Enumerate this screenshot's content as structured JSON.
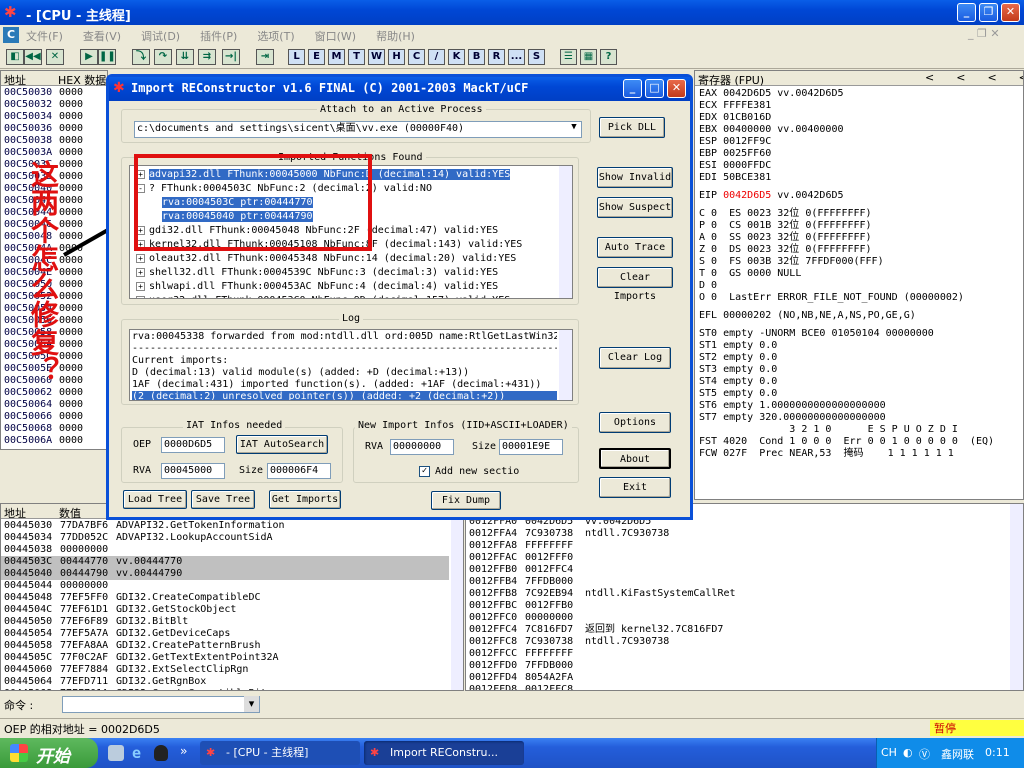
{
  "main_window": {
    "title": "- [CPU - 主线程]",
    "menu": [
      "文件(F)",
      "查看(V)",
      "调试(D)",
      "插件(P)",
      "选项(T)",
      "窗口(W)",
      "帮助(H)"
    ],
    "toolbar_letters": [
      "L",
      "E",
      "M",
      "T",
      "W",
      "H",
      "C",
      "/",
      "K",
      "B",
      "R",
      "...",
      "S"
    ]
  },
  "dump_panel": {
    "col_addr": "地址",
    "col_hex": "HEX 数据",
    "rows": [
      [
        "00C50030",
        "0000"
      ],
      [
        "00C50032",
        "0000"
      ],
      [
        "00C50034",
        "0000"
      ],
      [
        "00C50036",
        "0000"
      ],
      [
        "00C50038",
        "0000"
      ],
      [
        "00C5003A",
        "0000"
      ],
      [
        "00C5003C",
        "0000"
      ],
      [
        "00C5003E",
        "0000"
      ],
      [
        "00C50040",
        "0000"
      ],
      [
        "00C50042",
        "0000"
      ],
      [
        "00C50044",
        "0000"
      ],
      [
        "00C50046",
        "0000"
      ],
      [
        "00C50048",
        "0000"
      ],
      [
        "00C5004A",
        "0000"
      ],
      [
        "00C5004C",
        "0000"
      ],
      [
        "00C5004E",
        "0000"
      ],
      [
        "00C50050",
        "0000"
      ],
      [
        "00C50052",
        "0000"
      ],
      [
        "00C50054",
        "0000"
      ],
      [
        "00C50056",
        "0000"
      ],
      [
        "00C50058",
        "0000"
      ],
      [
        "00C5005A",
        "0000"
      ],
      [
        "00C5005C",
        "0000"
      ],
      [
        "00C5005E",
        "0000"
      ],
      [
        "00C50060",
        "0000"
      ],
      [
        "00C50062",
        "0000"
      ],
      [
        "00C50064",
        "0000"
      ],
      [
        "00C50066",
        "0000"
      ],
      [
        "00C50068",
        "0000"
      ],
      [
        "00C5006A",
        "0000"
      ]
    ]
  },
  "annotation": {
    "text": "这两个怎么修复？"
  },
  "registers": {
    "header": "寄存器 (FPU)",
    "nav": [
      "<",
      "<",
      "<",
      "<",
      ">"
    ],
    "lines": [
      {
        "t": "EAX 0042D6D5 vv.0042D6D5"
      },
      {
        "t": "ECX FFFFE381"
      },
      {
        "t": "EDX 01CB016D"
      },
      {
        "t": "EBX 00400000 vv.00400000"
      },
      {
        "t": "ESP 0012FF9C"
      },
      {
        "t": "EBP 0025FF60"
      },
      {
        "t": "ESI 0000FFDC"
      },
      {
        "t": "EDI 50BCE381"
      },
      {
        "t": ""
      },
      {
        "t": "EIP ",
        "red": "0042D6D5",
        "rest": " vv.0042D6D5"
      },
      {
        "t": ""
      },
      {
        "t": "C 0  ES 0023 32位 0(FFFFFFFF)"
      },
      {
        "t": "P 0  CS 001B 32位 0(FFFFFFFF)"
      },
      {
        "t": "A 0  SS 0023 32位 0(FFFFFFFF)"
      },
      {
        "t": "Z 0  DS 0023 32位 0(FFFFFFFF)"
      },
      {
        "t": "S 0  FS 003B 32位 7FFDF000(FFF)"
      },
      {
        "t": "T 0  GS 0000 NULL"
      },
      {
        "t": "D 0"
      },
      {
        "t": "O 0  LastErr ERROR_FILE_NOT_FOUND (00000002)"
      },
      {
        "t": ""
      },
      {
        "t": "EFL 00000202 (NO,NB,NE,A,NS,PO,GE,G)"
      },
      {
        "t": ""
      },
      {
        "t": "ST0 empty -UNORM BCE0 01050104 00000000"
      },
      {
        "t": "ST1 empty 0.0"
      },
      {
        "t": "ST2 empty 0.0"
      },
      {
        "t": "ST3 empty 0.0"
      },
      {
        "t": "ST4 empty 0.0"
      },
      {
        "t": "ST5 empty 0.0"
      },
      {
        "t": "ST6 empty 1.0000000000000000000"
      },
      {
        "t": "ST7 empty 320.00000000000000000"
      },
      {
        "t": "               3 2 1 0      E S P U O Z D I"
      },
      {
        "t": "FST 4020  Cond 1 0 0 0  Err 0 0 1 0 0 0 0 0  (EQ)"
      },
      {
        "t": "FCW 027F  Prec NEAR,53  掩码    1 1 1 1 1 1"
      }
    ]
  },
  "iat_panel": {
    "col_addr": "地址",
    "col_val": "数值",
    "rows": [
      {
        "a": "00445030",
        "v": "77DA7BF6",
        "c": "ADVAPI32.GetTokenInformation"
      },
      {
        "a": "00445034",
        "v": "77DD052C",
        "c": "ADVAPI32.LookupAccountSidA"
      },
      {
        "a": "00445038",
        "v": "00000000",
        "c": ""
      },
      {
        "a": "0044503C",
        "v": "00444770",
        "c": "vv.00444770",
        "hl": true
      },
      {
        "a": "00445040",
        "v": "00444790",
        "c": "vv.00444790",
        "hl": true
      },
      {
        "a": "00445044",
        "v": "00000000",
        "c": ""
      },
      {
        "a": "00445048",
        "v": "77EF5FF0",
        "c": "GDI32.CreateCompatibleDC"
      },
      {
        "a": "0044504C",
        "v": "77EF61D1",
        "c": "GDI32.GetStockObject"
      },
      {
        "a": "00445050",
        "v": "77EF6F89",
        "c": "GDI32.BitBlt"
      },
      {
        "a": "00445054",
        "v": "77EF5A7A",
        "c": "GDI32.GetDeviceCaps"
      },
      {
        "a": "00445058",
        "v": "77EFA8AA",
        "c": "GDI32.CreatePatternBrush"
      },
      {
        "a": "0044505C",
        "v": "77F0C2AF",
        "c": "GDI32.GetTextExtentPoint32A"
      },
      {
        "a": "00445060",
        "v": "77EF7884",
        "c": "GDI32.ExtSelectClipRgn"
      },
      {
        "a": "00445064",
        "v": "77EFD711",
        "c": "GDI32.GetRgnBox"
      },
      {
        "a": "00445068",
        "v": "77EF701A",
        "c": "GDI32.CreateCompatibleBitmap"
      }
    ]
  },
  "stack_panel": {
    "rows": [
      {
        "a": "0012FFA0",
        "v": "0042D6D5",
        "c": "vv.0042D6D5"
      },
      {
        "a": "0012FFA4",
        "v": "7C930738",
        "c": "ntdll.7C930738"
      },
      {
        "a": "0012FFA8",
        "v": "FFFFFFFF",
        "c": ""
      },
      {
        "a": "0012FFAC",
        "v": "0012FFF0",
        "c": ""
      },
      {
        "a": "0012FFB0",
        "v": "0012FFC4",
        "c": ""
      },
      {
        "a": "0012FFB4",
        "v": "7FFDB000",
        "c": ""
      },
      {
        "a": "0012FFB8",
        "v": "7C92EB94",
        "c": "ntdll.KiFastSystemCallRet"
      },
      {
        "a": "0012FFBC",
        "v": "0012FFB0",
        "c": ""
      },
      {
        "a": "0012FFC0",
        "v": "00000000",
        "c": ""
      },
      {
        "a": "0012FFC4",
        "v": "7C816FD7",
        "c": "返回到 kernel32.7C816FD7"
      },
      {
        "a": "0012FFC8",
        "v": "7C930738",
        "c": "ntdll.7C930738"
      },
      {
        "a": "0012FFCC",
        "v": "FFFFFFFF",
        "c": ""
      },
      {
        "a": "0012FFD0",
        "v": "7FFDB000",
        "c": ""
      },
      {
        "a": "0012FFD4",
        "v": "8054A2FA",
        "c": ""
      },
      {
        "a": "0012FFD8",
        "v": "0012FFC8",
        "c": ""
      }
    ]
  },
  "command": {
    "label": "命令 :",
    "value": ""
  },
  "status": {
    "text": "OEP 的相对地址 = 0002D6D5",
    "state": "暂停"
  },
  "dialog": {
    "title": "Import REConstructor v1.6 FINAL (C) 2001-2003 MackT/uCF",
    "attach_label": "Attach to an Active Process",
    "process": "c:\\documents and settings\\sicent\\桌面\\vv.exe (00000F40)",
    "pick_dll": "Pick DLL",
    "imports_label": "Imported Functions Found",
    "tree": [
      {
        "t": "advapi32.dll FThunk:00045000 NbFunc:D (decimal:14) valid:YES",
        "sel": true,
        "exp": "+"
      },
      {
        "t": "? FThunk:0004503C NbFunc:2 (decimal:2) valid:NO",
        "exp": "-"
      },
      {
        "t": "rva:0004503C ptr:00444770",
        "sel": true,
        "child": true
      },
      {
        "t": "rva:00045040 ptr:00444790",
        "sel": true,
        "child": true
      },
      {
        "t": "gdi32.dll FThunk:00045048 NbFunc:2F (decimal:47) valid:YES",
        "exp": "+"
      },
      {
        "t": "kernel32.dll FThunk:00045108 NbFunc:8F (decimal:143) valid:YES",
        "exp": "+"
      },
      {
        "t": "oleaut32.dll FThunk:00045348 NbFunc:14 (decimal:20) valid:YES",
        "exp": "+"
      },
      {
        "t": "shell32.dll FThunk:0004539C NbFunc:3 (decimal:3) valid:YES",
        "exp": "+"
      },
      {
        "t": "shlwapi.dll FThunk:000453AC NbFunc:4 (decimal:4) valid:YES",
        "exp": "+"
      },
      {
        "t": "user32.dll FThunk:000453C0 NbFunc:9D (decimal:157) valid:YES",
        "exp": "+"
      }
    ],
    "side_buttons": [
      "Show Invalid",
      "Show Suspect",
      "Auto Trace",
      "Clear Imports"
    ],
    "log_label": "Log",
    "log": [
      {
        "t": "rva:00045338 forwarded from mod:ntdll.dll ord:005D name:RtlGetLastWin32"
      },
      {
        "t": "------------------------------------------------------------------------"
      },
      {
        "t": "Current imports:"
      },
      {
        "t": "D (decimal:13) valid module(s) (added: +D (decimal:+13))"
      },
      {
        "t": "1AF (decimal:431) imported function(s). (added: +1AF (decimal:+431))"
      },
      {
        "t": "(2 (decimal:2) unresolved pointer(s)) (added: +2 (decimal:+2))",
        "sel": true
      }
    ],
    "clear_log": "Clear Log",
    "iat_label": "IAT Infos needed",
    "oep_label": "OEP",
    "oep": "0000D6D5",
    "autosearch": "IAT AutoSearch",
    "rva_label": "RVA",
    "rva": "00045000",
    "size_label": "Size",
    "size": "000006F4",
    "new_label": "New Import Infos (IID+ASCII+LOADER)",
    "new_rva_label": "RVA",
    "new_rva": "00000000",
    "new_size_label": "Size",
    "new_size": "00001E9E",
    "add_section": "Add new sectio",
    "load_tree": "Load Tree",
    "save_tree": "Save Tree",
    "get_imports": "Get Imports",
    "fix_dump": "Fix Dump",
    "options": "Options",
    "about": "About",
    "exit": "Exit"
  },
  "taskbar": {
    "start": "开始",
    "task1": "- [CPU - 主线程]",
    "task2": "Import REConstru...",
    "ime": "CH",
    "brand": "鑫网联",
    "clock": "0:11"
  }
}
